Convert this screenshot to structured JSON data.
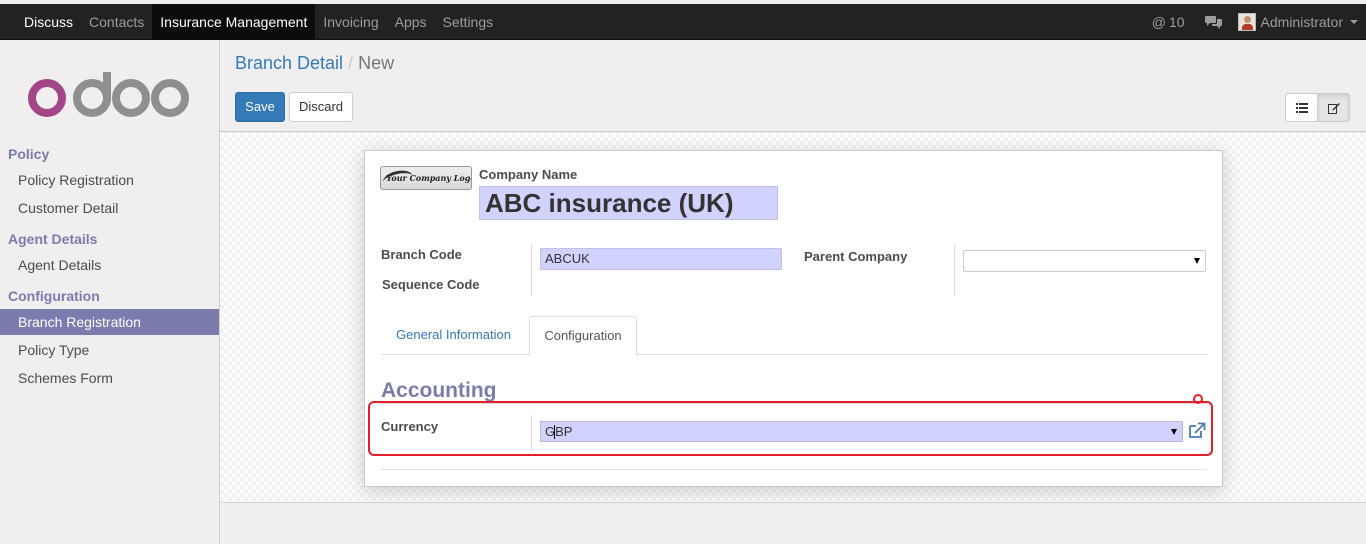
{
  "topbar": {
    "menu": [
      "Discuss",
      "Contacts",
      "Insurance Management",
      "Invoicing",
      "Apps",
      "Settings"
    ],
    "mentions_count": "10",
    "user_name": "Administrator"
  },
  "logo_text": "odoo",
  "sidebar": {
    "sections": [
      {
        "title": "Policy",
        "items": [
          "Policy Registration",
          "Customer Detail"
        ]
      },
      {
        "title": "Agent Details",
        "items": [
          "Agent Details"
        ]
      },
      {
        "title": "Configuration",
        "items": [
          "Branch Registration",
          "Policy Type",
          "Schemes Form"
        ]
      }
    ],
    "active_item": "Branch Registration"
  },
  "breadcrumb": {
    "parent": "Branch Detail",
    "separator": "/",
    "current": "New"
  },
  "buttons": {
    "save": "Save",
    "discard": "Discard"
  },
  "form": {
    "logo_text": "Your Company Logo",
    "company_name_label": "Company Name",
    "company_name_value": "ABC insurance (UK)",
    "branch_code_label": "Branch Code",
    "branch_code_value": "ABCUK",
    "sequence_code_label": "Sequence Code",
    "parent_company_label": "Parent Company",
    "parent_company_value": "",
    "tabs": [
      "General Information",
      "Configuration"
    ],
    "active_tab": "Configuration",
    "section_title": "Accounting",
    "currency_label": "Currency",
    "currency_value": "GBP"
  },
  "colors": {
    "navbar": "#222222",
    "accent": "#7c7bad",
    "primary_button": "#337ab7",
    "required_field": "#d2d2ff",
    "highlight": "#e0202a"
  }
}
